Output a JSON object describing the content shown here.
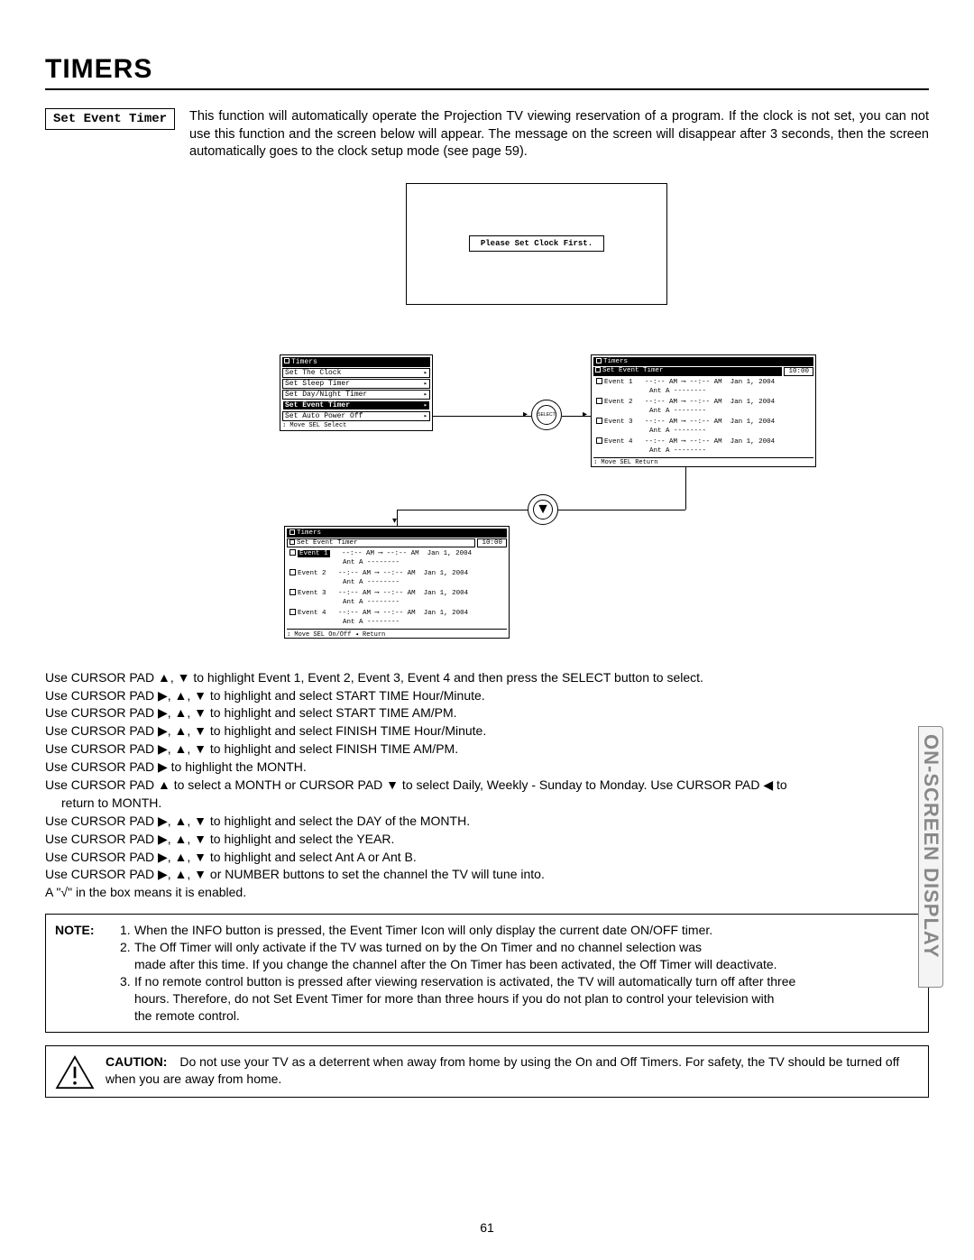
{
  "page": {
    "title": "TIMERS",
    "section_label": "Set Event Timer",
    "intro_text": "This function will automatically operate the Projection TV viewing reservation of a program.  If the clock is not set, you can not use this function and the screen below will appear.  The message on the screen will disappear after 3 seconds, then the screen automatically goes to the clock setup mode (see page 59).",
    "side_tab": "ON-SCREEN DISPLAY",
    "page_number": "61"
  },
  "clock_screen": {
    "message": "Please Set Clock First."
  },
  "timers_menu": {
    "title": "Timers",
    "items": [
      "Set The Clock",
      "Set Sleep Timer",
      "Set Day/Night Timer",
      "Set Event Timer",
      "Set Auto Power Off"
    ],
    "highlighted_index": 3,
    "footer": "↕ Move   SEL  Select"
  },
  "event_screen_right": {
    "title": "Timers",
    "subtitle": "Set Event Timer",
    "time": "10:00",
    "events": [
      {
        "label": "Event 1",
        "start": "--:--  AM",
        "end": "--:--  AM",
        "date": "Jan 1, 2004",
        "ant": "Ant A --------"
      },
      {
        "label": "Event 2",
        "start": "--:--  AM",
        "end": "--:--  AM",
        "date": "Jan 1, 2004",
        "ant": "Ant A --------"
      },
      {
        "label": "Event 3",
        "start": "--:--  AM",
        "end": "--:--  AM",
        "date": "Jan 1, 2004",
        "ant": "Ant A --------"
      },
      {
        "label": "Event 4",
        "start": "--:--  AM",
        "end": "--:--  AM",
        "date": "Jan 1, 2004",
        "ant": "Ant A --------"
      }
    ],
    "footer": "↕ Move  SEL  Return"
  },
  "event_screen_bottom": {
    "title": "Timers",
    "subtitle": "Set Event Timer",
    "time": "10:00",
    "highlighted_event": "Event 1",
    "events": [
      {
        "label": "Event 1",
        "start": "--:--  AM",
        "end": "--:--  AM",
        "date": "Jan 1, 2004",
        "ant": "Ant A --------"
      },
      {
        "label": "Event 2",
        "start": "--:--  AM",
        "end": "--:--  AM",
        "date": "Jan 1, 2004",
        "ant": "Ant A --------"
      },
      {
        "label": "Event 3",
        "start": "--:--  AM",
        "end": "--:--  AM",
        "date": "Jan 1, 2004",
        "ant": "Ant A --------"
      },
      {
        "label": "Event 4",
        "start": "--:--  AM",
        "end": "--:--  AM",
        "date": "Jan 1, 2004",
        "ant": "Ant A --------"
      }
    ],
    "footer": "↕ Move  SEL  On/Off ◂ Return"
  },
  "instructions": [
    "Use CURSOR PAD ▲, ▼ to highlight Event 1, Event 2, Event 3, Event 4 and then press the SELECT button to select.",
    "Use CURSOR PAD ▶, ▲, ▼ to highlight and select START TIME Hour/Minute.",
    "Use CURSOR PAD ▶, ▲, ▼ to highlight and select START TIME AM/PM.",
    "Use CURSOR PAD ▶, ▲, ▼ to highlight and select FINISH TIME Hour/Minute.",
    "Use CURSOR PAD ▶, ▲, ▼ to highlight and select FINISH TIME AM/PM.",
    "Use CURSOR PAD ▶ to highlight the MONTH.",
    "Use CURSOR PAD ▲ to select a MONTH or CURSOR PAD ▼ to select Daily, Weekly - Sunday to Monday.  Use CURSOR PAD ◀ to",
    "return to MONTH.",
    "Use CURSOR PAD ▶, ▲, ▼ to highlight and select the DAY of the MONTH.",
    "Use CURSOR PAD ▶, ▲, ▼ to highlight and select the YEAR.",
    "Use CURSOR PAD ▶, ▲, ▼ to highlight and select Ant A or Ant B.",
    "Use CURSOR PAD ▶, ▲, ▼ or NUMBER buttons to set the channel the TV will tune into.",
    "A \"√\" in the box means it is enabled."
  ],
  "note": {
    "label": "NOTE:",
    "items": [
      {
        "n": "1.",
        "text": "When the INFO button is pressed, the Event Timer Icon will only display the current date ON/OFF timer."
      },
      {
        "n": "2.",
        "text": "The Off Timer will only activate if the TV was turned on by the On Timer and no channel selection was",
        "cont": "made after this time.  If you change the channel after the On Timer has been activated, the Off Timer will deactivate."
      },
      {
        "n": "3.",
        "text": "If no remote control button is pressed after viewing reservation is activated, the TV will automatically turn off after three",
        "cont": "hours.  Therefore, do not Set Event Timer for more than three hours if you do not plan to control your television with",
        "cont2": "the remote control."
      }
    ]
  },
  "caution": {
    "label": "CAUTION:",
    "text": "Do not use your TV as a deterrent when away from home by using the On and Off Timers.  For safety, the TV should be turned off when you are away from home."
  }
}
